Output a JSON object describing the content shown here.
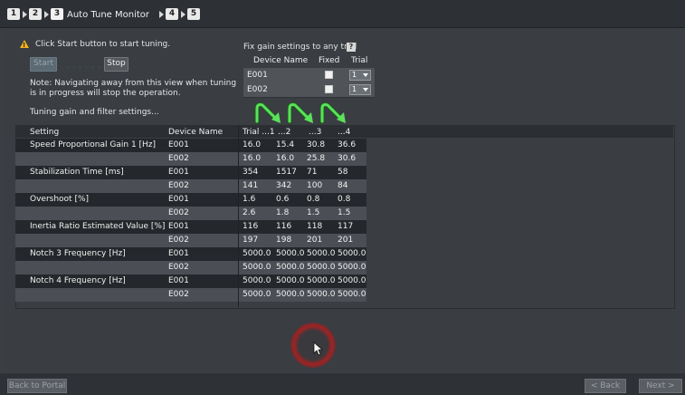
{
  "breadcrumb": {
    "steps": [
      "1",
      "2",
      "3",
      "4",
      "5"
    ],
    "active_title": "Auto Tune Monitor"
  },
  "controls": {
    "instruction": "Click Start button to start tuning.",
    "start_label": "Start",
    "stop_label": "Stop",
    "note_line1": "Note: Navigating away from this view when tuning",
    "note_line2": "is in progress will stop the operation.",
    "tuning_label": "Tuning gain and filter settings..."
  },
  "fix_gain": {
    "title": "Fix gain settings to any trial",
    "help_icon": "?",
    "headers": [
      "Device Name",
      "Fixed",
      "Trial"
    ],
    "rows": [
      {
        "device": "E001",
        "fixed": false,
        "trial": "1"
      },
      {
        "device": "E002",
        "fixed": false,
        "trial": "1"
      }
    ]
  },
  "table": {
    "headers": [
      "Setting",
      "Device Name",
      "Trial ...1",
      "...2",
      "...3",
      "...4"
    ],
    "rows": [
      {
        "setting": "Speed Proportional Gain 1 [Hz]",
        "device": "E001",
        "vals": [
          "16.0",
          "15.4",
          "30.8",
          "36.6"
        ]
      },
      {
        "setting": "",
        "device": "E002",
        "vals": [
          "16.0",
          "16.0",
          "25.8",
          "30.6"
        ]
      },
      {
        "setting": "Stabilization Time [ms]",
        "device": "E001",
        "vals": [
          "354",
          "1517",
          "71",
          "58"
        ]
      },
      {
        "setting": "",
        "device": "E002",
        "vals": [
          "141",
          "342",
          "100",
          "84"
        ]
      },
      {
        "setting": "Overshoot [%]",
        "device": "E001",
        "vals": [
          "1.6",
          "0.6",
          "0.8",
          "0.8"
        ]
      },
      {
        "setting": "",
        "device": "E002",
        "vals": [
          "2.6",
          "1.8",
          "1.5",
          "1.5"
        ]
      },
      {
        "setting": "Inertia Ratio Estimated Value [%]",
        "device": "E001",
        "vals": [
          "116",
          "116",
          "118",
          "117"
        ]
      },
      {
        "setting": "",
        "device": "E002",
        "vals": [
          "197",
          "198",
          "201",
          "201"
        ]
      },
      {
        "setting": "Notch 3 Frequency [Hz]",
        "device": "E001",
        "vals": [
          "5000.0",
          "5000.0",
          "5000.0",
          "5000.0"
        ]
      },
      {
        "setting": "",
        "device": "E002",
        "vals": [
          "5000.0",
          "5000.0",
          "5000.0",
          "5000.0"
        ]
      },
      {
        "setting": "Notch 4 Frequency [Hz]",
        "device": "E001",
        "vals": [
          "5000.0",
          "5000.0",
          "5000.0",
          "5000.0"
        ]
      },
      {
        "setting": "",
        "device": "E002",
        "vals": [
          "5000.0",
          "5000.0",
          "5000.0",
          "5000.0"
        ]
      }
    ]
  },
  "footer": {
    "back_label": "Back to Portal",
    "prev_label": "< Back",
    "next_label": "Next >"
  },
  "colors": {
    "accent_green": "#3fbf3f",
    "warning": "#f2b01e"
  },
  "icons": [
    "warning-icon",
    "help-icon",
    "trial-arrow-icon",
    "cursor-icon"
  ]
}
